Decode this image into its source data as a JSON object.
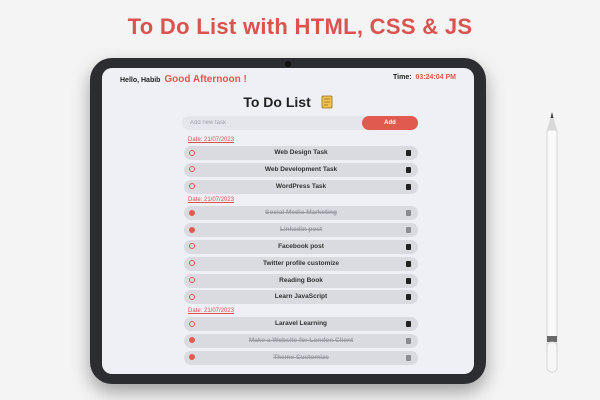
{
  "banner": {
    "title": "To Do List with HTML, CSS & JS"
  },
  "header": {
    "greeting_prefix": "Hello, Habib",
    "greeting_daypart": "Good Afternoon !",
    "time_label": "Time:",
    "time_value": "03:24:04 PM"
  },
  "app": {
    "title": "To Do List",
    "input_placeholder": "Add new task",
    "add_label": "Add"
  },
  "groups": [
    {
      "date": "Date: 21/07/2023",
      "tasks": [
        {
          "label": "Web Design Task",
          "done": false
        },
        {
          "label": "Web Development Task",
          "done": false
        },
        {
          "label": "WordPress Task",
          "done": false
        }
      ]
    },
    {
      "date": "Date: 21/07/2023",
      "tasks": [
        {
          "label": "Social Media Marketing",
          "done": true
        },
        {
          "label": "Linkedin post",
          "done": true
        },
        {
          "label": "Facebook post",
          "done": false
        },
        {
          "label": "Twitter profile customize",
          "done": false
        },
        {
          "label": "Reading Book",
          "done": false
        },
        {
          "label": "Learn JavaScript",
          "done": false
        }
      ]
    },
    {
      "date": "Date: 21/07/2023",
      "tasks": [
        {
          "label": "Laravel Learning",
          "done": false
        },
        {
          "label": "Make a Website for London Client",
          "done": true
        },
        {
          "label": "Theme Customize",
          "done": true
        }
      ]
    }
  ],
  "colors": {
    "accent": "#e05a4f",
    "device": "#2b2d31",
    "screen": "#eef0f5"
  }
}
